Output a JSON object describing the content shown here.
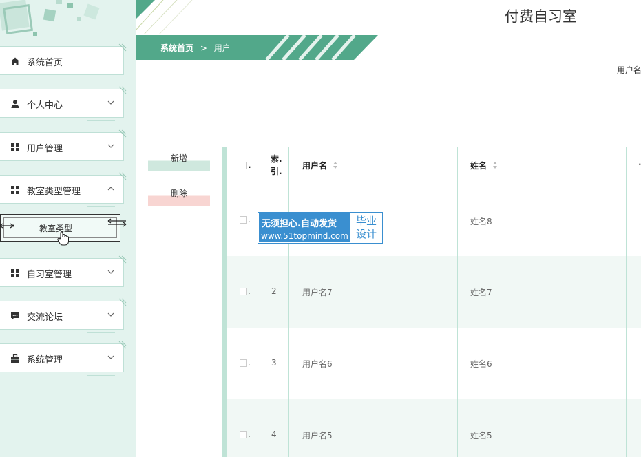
{
  "app": {
    "title": "付费自习室"
  },
  "breadcrumb": {
    "home": "系统首页",
    "separator": ">",
    "current": "用户"
  },
  "search": {
    "label": "用户名"
  },
  "sidebar": {
    "items": [
      {
        "label": "系统首页",
        "icon": "home-icon"
      },
      {
        "label": "个人中心",
        "icon": "person-icon"
      },
      {
        "label": "用户管理",
        "icon": "grid-icon"
      },
      {
        "label": "教室类型管理",
        "icon": "grid-icon"
      },
      {
        "label": "自习室管理",
        "icon": "grid-icon"
      },
      {
        "label": "交流论坛",
        "icon": "chat-icon"
      },
      {
        "label": "系统管理",
        "icon": "briefcase-icon"
      }
    ],
    "submenu": {
      "label": "教室类型"
    }
  },
  "actions": {
    "add": "新增",
    "delete": "删除"
  },
  "table": {
    "headers": {
      "checkbox": ".",
      "index": "索.引.",
      "username": "用户名",
      "name": "姓名"
    },
    "rows": [
      {
        "index": "",
        "username": "",
        "name": "姓名8"
      },
      {
        "index": "2",
        "username": "用户名7",
        "name": "姓名7"
      },
      {
        "index": "3",
        "username": "用户名6",
        "name": "姓名6"
      },
      {
        "index": "4",
        "username": "用户名5",
        "name": "姓名5"
      }
    ]
  },
  "watermark": {
    "line1": "无须担心.自动发货",
    "line2": "www.51topmind.com",
    "badge1": "毕业",
    "badge2": "设计"
  },
  "colors": {
    "accent": "#52a88a",
    "sidebar_bg": "#e3f3ee",
    "row_alt": "#f1f8f5",
    "border": "#bfe3d6"
  }
}
